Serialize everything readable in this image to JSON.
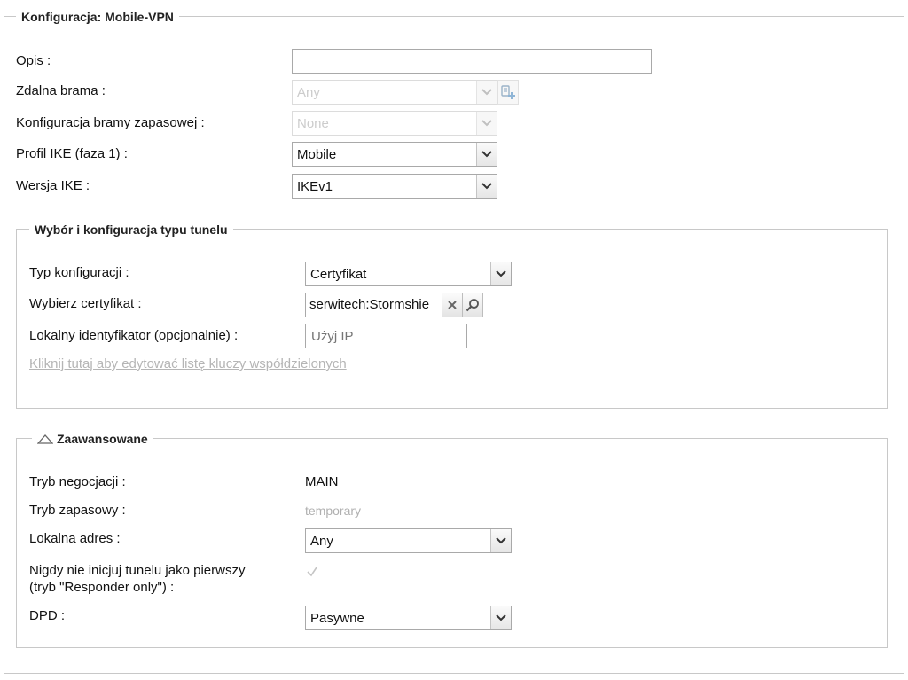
{
  "main": {
    "legend": "Konfiguracja: Mobile-VPN",
    "fields": {
      "opis_label": "Opis :",
      "opis_value": "",
      "zdalna_label": "Zdalna brama :",
      "zdalna_value": "Any",
      "zapasowa_label": "Konfiguracja bramy zapasowej :",
      "zapasowa_value": "None",
      "ike_profile_label": "Profil IKE (faza 1) :",
      "ike_profile_value": "Mobile",
      "ike_version_label": "Wersja IKE :",
      "ike_version_value": "IKEv1"
    }
  },
  "tunnel": {
    "legend": "Wybór i konfiguracja typu tunelu",
    "typ_label": "Typ konfiguracji :",
    "typ_value": "Certyfikat",
    "cert_label": "Wybierz certyfikat :",
    "cert_value": "serwitech:Stormshie",
    "local_id_label": "Lokalny identyfikator (opcjonalnie) :",
    "local_id_placeholder": "Użyj IP",
    "psk_link": "Kliknij tutaj aby edytować listę kluczy współdzielonych"
  },
  "advanced": {
    "legend": "Zaawansowane",
    "nego_label": "Tryb negocjacji :",
    "nego_value": "MAIN",
    "backup_label": "Tryb zapasowy :",
    "backup_value": "temporary",
    "local_addr_label": "Lokalna adres :",
    "local_addr_value": "Any",
    "responder_label_1": "Nigdy nie inicjuj tunelu jako pierwszy",
    "responder_label_2": "(tryb \"Responder only\") :",
    "responder_checked": true,
    "dpd_label": "DPD :",
    "dpd_value": "Pasywne"
  },
  "icons": {
    "dropdown": "chevron-down-icon",
    "add_object": "add-object-icon",
    "clear": "clear-icon",
    "search": "search-icon",
    "collapse": "collapse-triangle-icon",
    "check": "checkmark-icon"
  },
  "colors": {
    "border": "#c8c8c8",
    "link_disabled": "#b5b5b5",
    "text": "#111111"
  }
}
